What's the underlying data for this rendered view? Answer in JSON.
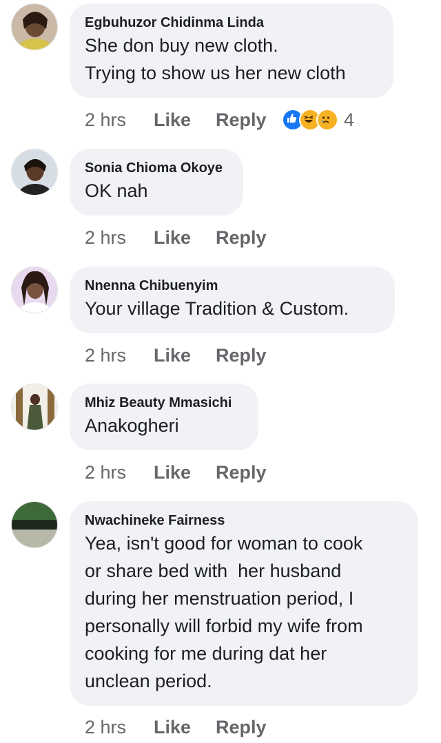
{
  "comments": [
    {
      "author": "Egbuhuzor Chidinma Linda",
      "lines": [
        "She don buy new cloth.",
        "Trying to show us her new cloth"
      ],
      "time": "2 hrs",
      "like": "Like",
      "reply": "Reply",
      "reactions": {
        "icons": [
          "like-reaction-icon",
          "haha-reaction-icon",
          "sad-reaction-icon"
        ],
        "count": "4"
      }
    },
    {
      "author": "Sonia Chioma Okoye",
      "lines": [
        "OK nah"
      ],
      "time": "2 hrs",
      "like": "Like",
      "reply": "Reply"
    },
    {
      "author": "Nnenna Chibuenyim",
      "lines": [
        "Your village Tradition & Custom."
      ],
      "time": "2 hrs",
      "like": "Like",
      "reply": "Reply"
    },
    {
      "author": "Mhiz Beauty Mmasichi",
      "lines": [
        "Anakogheri"
      ],
      "time": "2 hrs",
      "like": "Like",
      "reply": "Reply"
    },
    {
      "author": "Nwachineke Fairness",
      "lines": [
        "Yea, isn't good for woman to cook",
        "or share bed with  her husband",
        "during her menstruation period, I",
        "personally will forbid my wife from",
        "cooking for me during dat her",
        "unclean period."
      ],
      "time": "2 hrs",
      "like": "Like",
      "reply": "Reply"
    }
  ],
  "colors": {
    "bubble": "#f0f2f5",
    "name": "#1c1e21",
    "meta": "#65676b",
    "like_blue": "#1877f2",
    "reaction_yellow": "#f7b125"
  }
}
